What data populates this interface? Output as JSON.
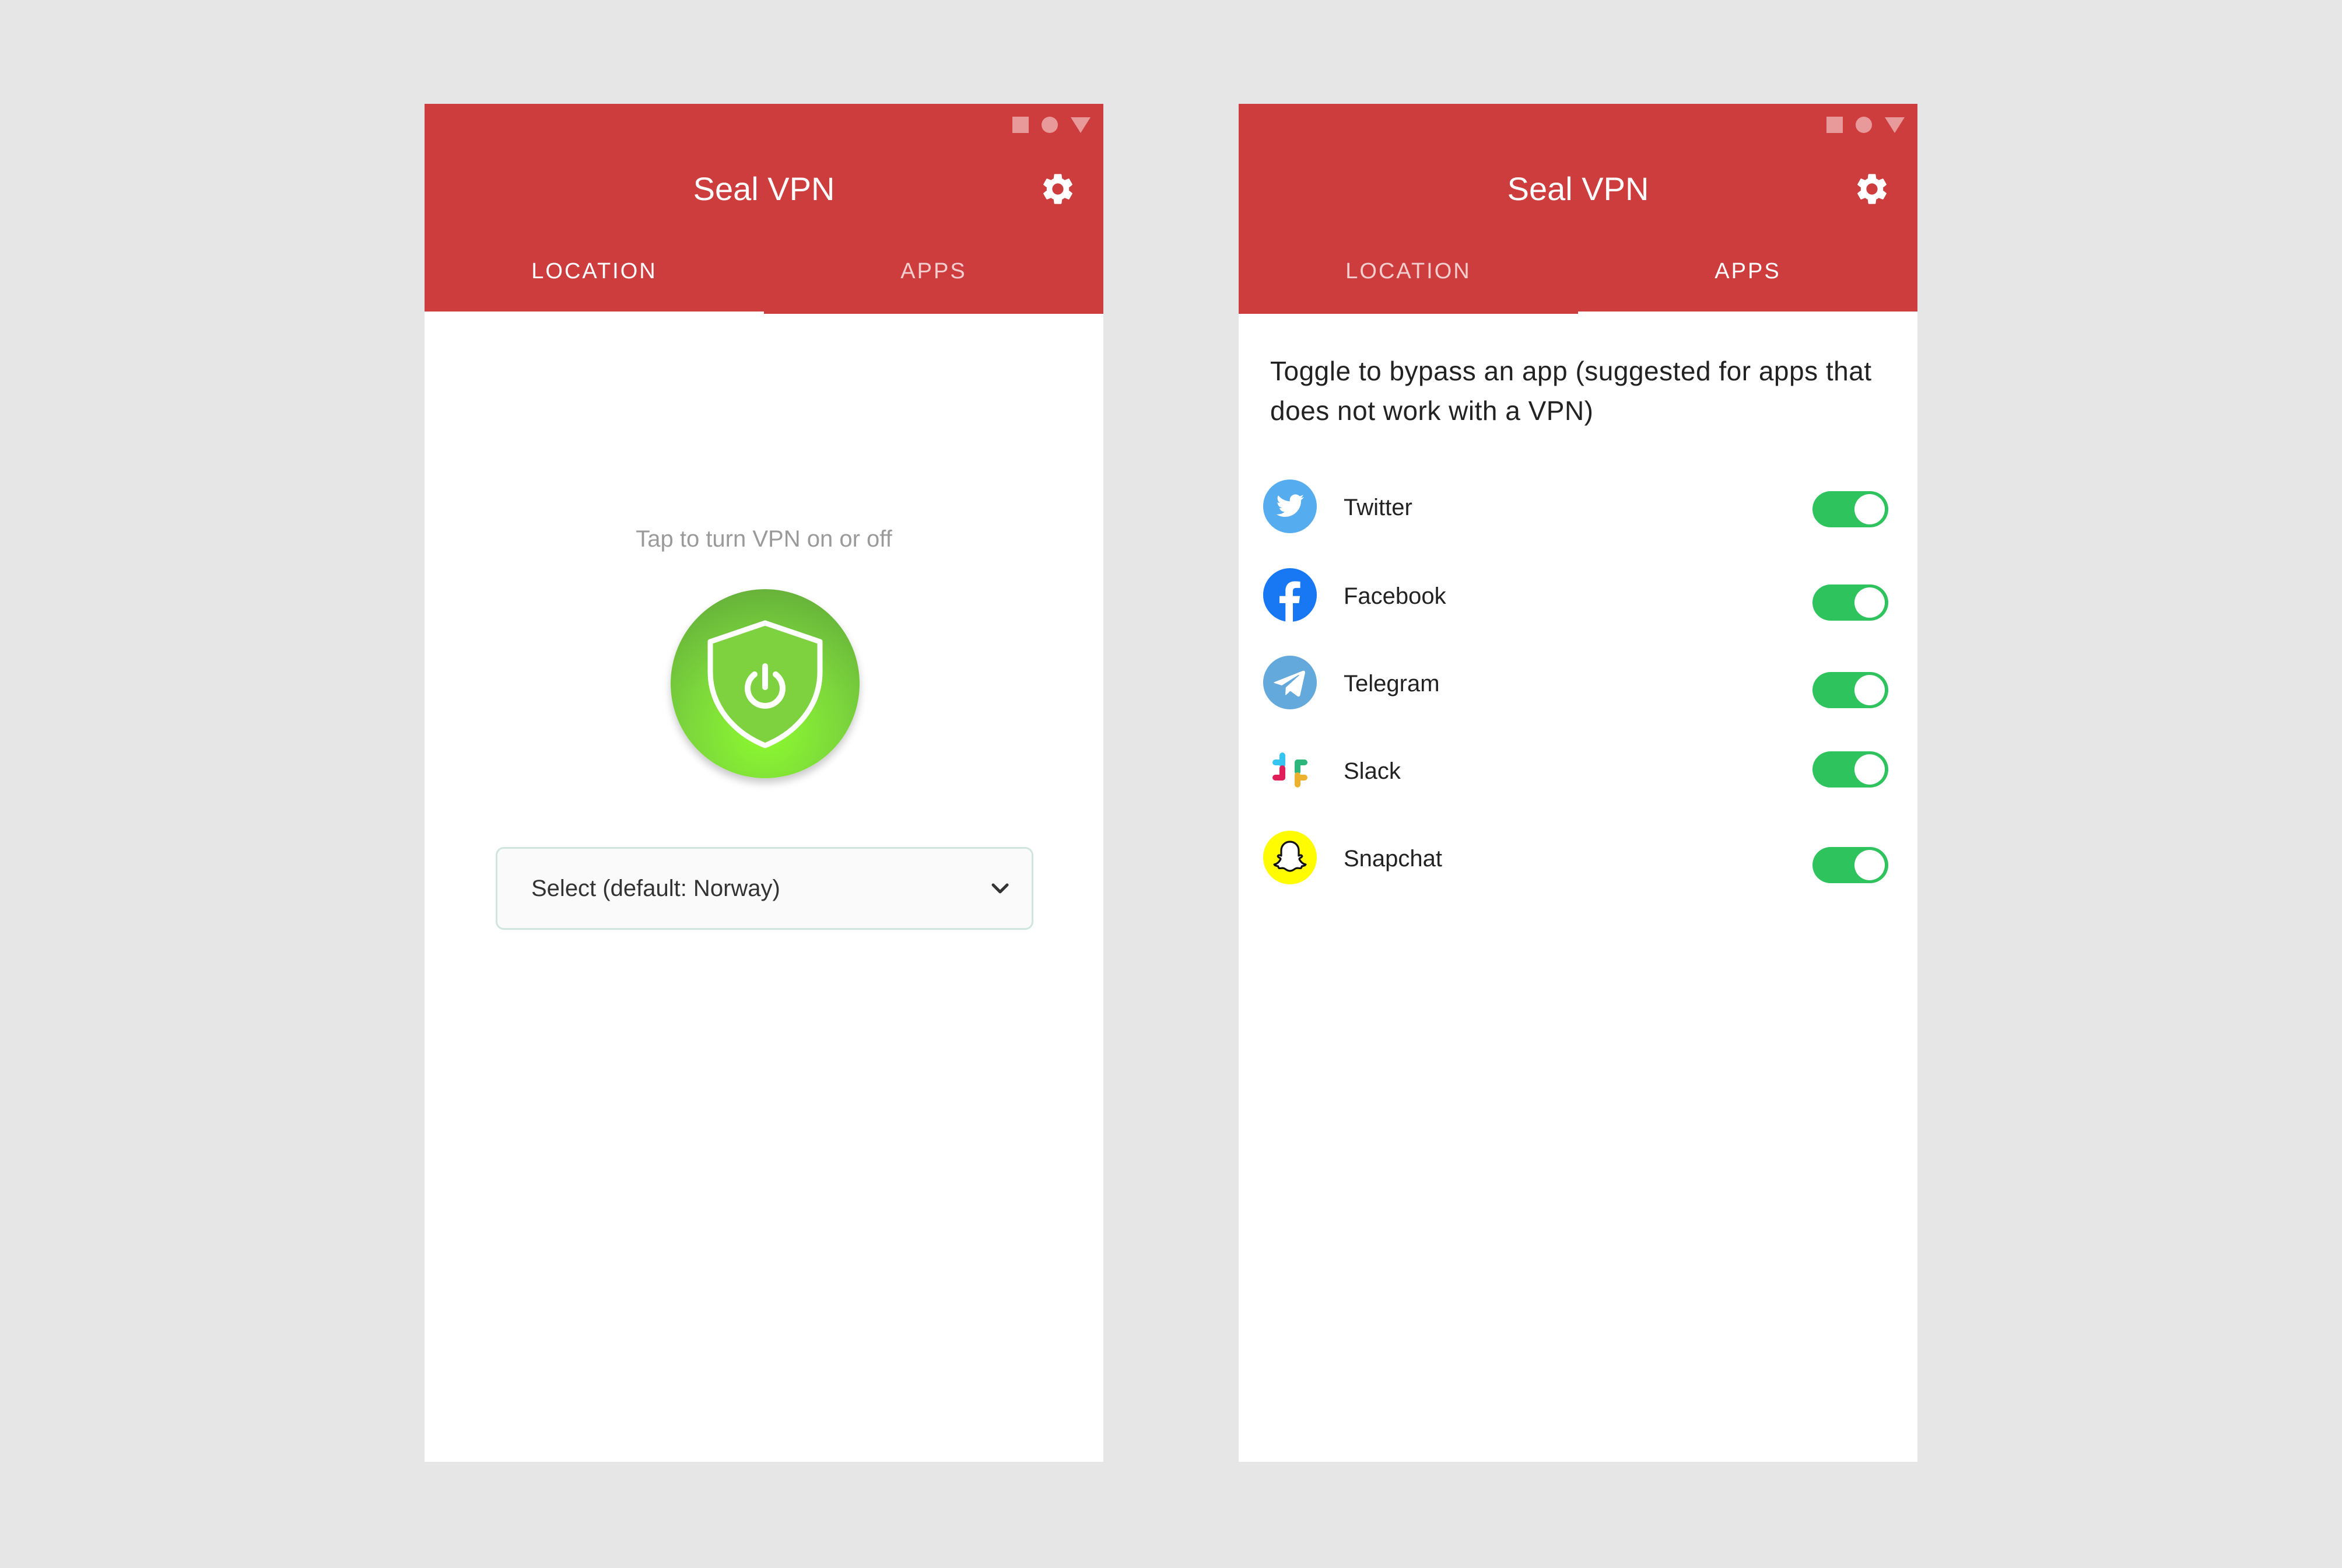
{
  "screens": [
    {
      "app_title": "Seal VPN",
      "tabs": [
        {
          "label": "LOCATION",
          "active": true
        },
        {
          "label": "APPS",
          "active": false
        }
      ],
      "tap_hint": "Tap to turn VPN on or off",
      "vpn_power": {
        "icon": "shield-power-icon",
        "state_color": "#7cd73c"
      },
      "location_select": {
        "value": "Select (default: Norway)",
        "icon": "chevron-down-icon"
      }
    },
    {
      "app_title": "Seal VPN",
      "tabs": [
        {
          "label": "LOCATION",
          "active": false
        },
        {
          "label": "APPS",
          "active": true
        }
      ],
      "instructions": "Toggle to bypass an app (suggested for apps that does not work with a VPN)",
      "apps": [
        {
          "name": "Twitter",
          "icon": "twitter-icon",
          "enabled": true
        },
        {
          "name": "Facebook",
          "icon": "facebook-icon",
          "enabled": true
        },
        {
          "name": "Telegram",
          "icon": "telegram-icon",
          "enabled": true
        },
        {
          "name": "Slack",
          "icon": "slack-icon",
          "enabled": true
        },
        {
          "name": "Snapchat",
          "icon": "snapchat-icon",
          "enabled": true
        }
      ]
    }
  ],
  "colors": {
    "brand_red": "#cd3d3e",
    "toggle_on": "#2fc35e",
    "vpn_on_green": "#7cd73c",
    "background": "#e6e6e6"
  }
}
